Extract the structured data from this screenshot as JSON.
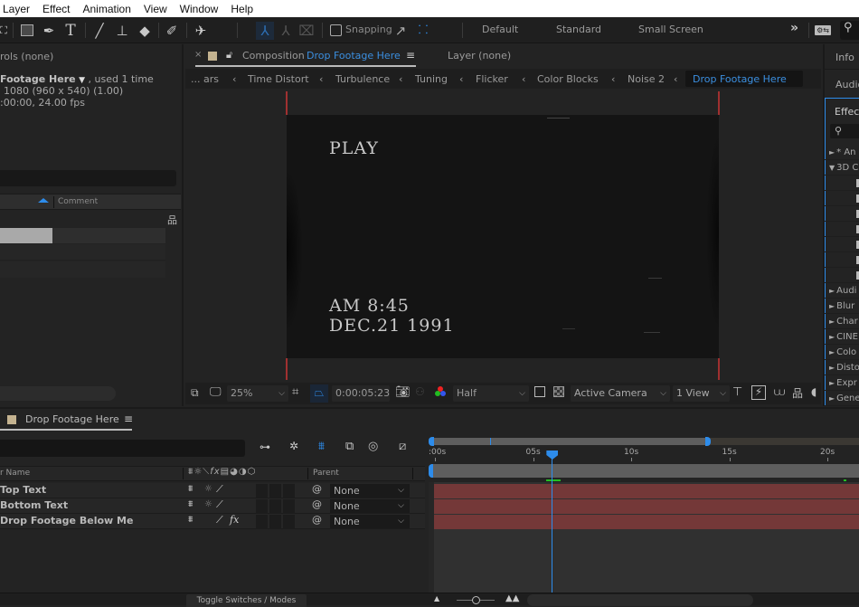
{
  "menubar": {
    "items": [
      "Layer",
      "Effect",
      "Animation",
      "View",
      "Window",
      "Help"
    ]
  },
  "toolbar": {
    "snapping_label": "Snapping",
    "workspaces": [
      "Default",
      "Standard",
      "Small Screen"
    ],
    "overflow_label": "»"
  },
  "left_panel": {
    "header": "rols (none)",
    "footage_name": "Footage Here",
    "used_text": ", used 1 time",
    "dimensions": "1080  (960 x 540) (1.00)",
    "duration_fps": ":00:00, 24.00 fps",
    "column_comment": "Comment"
  },
  "viewer": {
    "tab_prefix": "Composition",
    "comp_name": "Drop Footage Here",
    "layer_tab": "Layer (none)",
    "breadcrumbs": [
      "... ars",
      "Time Distort",
      "Turbulence",
      "Tuning",
      "Flicker",
      "Color Blocks",
      "Noise 2",
      "Drop Footage Here"
    ],
    "canvas": {
      "top_text": "PLAY",
      "bottom_line1": "AM 8:45",
      "bottom_line2": "DEC.21 1991"
    },
    "zoom": "25%",
    "timecode": "0:00:05:23",
    "resolution": "Half",
    "camera": "Active Camera",
    "views": "1 View"
  },
  "right_panel": {
    "tabs": [
      "Info",
      "Audio",
      "Effects"
    ],
    "effects_list": [
      {
        "label": "* An",
        "expanded": false
      },
      {
        "label": "3D C",
        "expanded": true
      },
      {
        "label": "Audi",
        "expanded": false
      },
      {
        "label": "Blur",
        "expanded": false
      },
      {
        "label": "Char",
        "expanded": false
      },
      {
        "label": "CINE",
        "expanded": false
      },
      {
        "label": "Colo",
        "expanded": false
      },
      {
        "label": "Disto",
        "expanded": false
      },
      {
        "label": "Expr",
        "expanded": false
      },
      {
        "label": "Gene",
        "expanded": false
      }
    ]
  },
  "timeline": {
    "tab_name": "Drop Footage Here",
    "col_layer_name": "r Name",
    "col_parent": "Parent",
    "layers": [
      {
        "name": "Top Text",
        "parent": "None",
        "has_fx": false
      },
      {
        "name": "Bottom Text",
        "parent": "None",
        "has_fx": false
      },
      {
        "name": "Drop Footage Below Me",
        "parent": "None",
        "has_fx": true
      }
    ],
    "ruler_labels": [
      ":00s",
      "05s",
      "10s",
      "15s",
      "20s"
    ],
    "current_time_seconds": 5.96,
    "toggle_label": "Toggle Switches / Modes"
  },
  "colors": {
    "accent": "#2d8ceb",
    "layer_bar": "#743838",
    "comp_swatch": "#c4b390",
    "work_area_green": "#22c022"
  }
}
